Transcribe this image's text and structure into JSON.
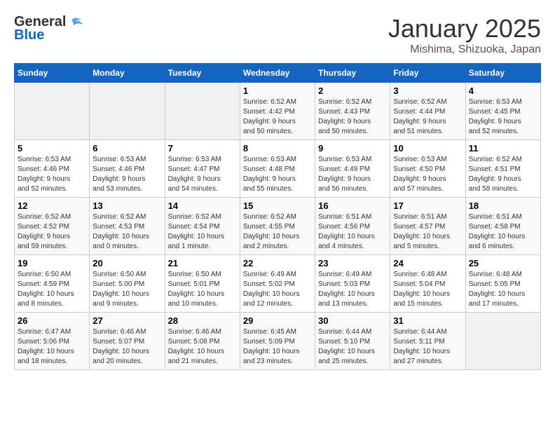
{
  "header": {
    "logo_general": "General",
    "logo_blue": "Blue",
    "month_title": "January 2025",
    "location": "Mishima, Shizuoka, Japan"
  },
  "days_of_week": [
    "Sunday",
    "Monday",
    "Tuesday",
    "Wednesday",
    "Thursday",
    "Friday",
    "Saturday"
  ],
  "weeks": [
    [
      {
        "day": "",
        "info": ""
      },
      {
        "day": "",
        "info": ""
      },
      {
        "day": "",
        "info": ""
      },
      {
        "day": "1",
        "info": "Sunrise: 6:52 AM\nSunset: 4:42 PM\nDaylight: 9 hours\nand 50 minutes."
      },
      {
        "day": "2",
        "info": "Sunrise: 6:52 AM\nSunset: 4:43 PM\nDaylight: 9 hours\nand 50 minutes."
      },
      {
        "day": "3",
        "info": "Sunrise: 6:52 AM\nSunset: 4:44 PM\nDaylight: 9 hours\nand 51 minutes."
      },
      {
        "day": "4",
        "info": "Sunrise: 6:53 AM\nSunset: 4:45 PM\nDaylight: 9 hours\nand 52 minutes."
      }
    ],
    [
      {
        "day": "5",
        "info": "Sunrise: 6:53 AM\nSunset: 4:46 PM\nDaylight: 9 hours\nand 52 minutes."
      },
      {
        "day": "6",
        "info": "Sunrise: 6:53 AM\nSunset: 4:46 PM\nDaylight: 9 hours\nand 53 minutes."
      },
      {
        "day": "7",
        "info": "Sunrise: 6:53 AM\nSunset: 4:47 PM\nDaylight: 9 hours\nand 54 minutes."
      },
      {
        "day": "8",
        "info": "Sunrise: 6:53 AM\nSunset: 4:48 PM\nDaylight: 9 hours\nand 55 minutes."
      },
      {
        "day": "9",
        "info": "Sunrise: 6:53 AM\nSunset: 4:49 PM\nDaylight: 9 hours\nand 56 minutes."
      },
      {
        "day": "10",
        "info": "Sunrise: 6:53 AM\nSunset: 4:50 PM\nDaylight: 9 hours\nand 57 minutes."
      },
      {
        "day": "11",
        "info": "Sunrise: 6:52 AM\nSunset: 4:51 PM\nDaylight: 9 hours\nand 58 minutes."
      }
    ],
    [
      {
        "day": "12",
        "info": "Sunrise: 6:52 AM\nSunset: 4:52 PM\nDaylight: 9 hours\nand 59 minutes."
      },
      {
        "day": "13",
        "info": "Sunrise: 6:52 AM\nSunset: 4:53 PM\nDaylight: 10 hours\nand 0 minutes."
      },
      {
        "day": "14",
        "info": "Sunrise: 6:52 AM\nSunset: 4:54 PM\nDaylight: 10 hours\nand 1 minute."
      },
      {
        "day": "15",
        "info": "Sunrise: 6:52 AM\nSunset: 4:55 PM\nDaylight: 10 hours\nand 2 minutes."
      },
      {
        "day": "16",
        "info": "Sunrise: 6:51 AM\nSunset: 4:56 PM\nDaylight: 10 hours\nand 4 minutes."
      },
      {
        "day": "17",
        "info": "Sunrise: 6:51 AM\nSunset: 4:57 PM\nDaylight: 10 hours\nand 5 minutes."
      },
      {
        "day": "18",
        "info": "Sunrise: 6:51 AM\nSunset: 4:58 PM\nDaylight: 10 hours\nand 6 minutes."
      }
    ],
    [
      {
        "day": "19",
        "info": "Sunrise: 6:50 AM\nSunset: 4:59 PM\nDaylight: 10 hours\nand 8 minutes."
      },
      {
        "day": "20",
        "info": "Sunrise: 6:50 AM\nSunset: 5:00 PM\nDaylight: 10 hours\nand 9 minutes."
      },
      {
        "day": "21",
        "info": "Sunrise: 6:50 AM\nSunset: 5:01 PM\nDaylight: 10 hours\nand 10 minutes."
      },
      {
        "day": "22",
        "info": "Sunrise: 6:49 AM\nSunset: 5:02 PM\nDaylight: 10 hours\nand 12 minutes."
      },
      {
        "day": "23",
        "info": "Sunrise: 6:49 AM\nSunset: 5:03 PM\nDaylight: 10 hours\nand 13 minutes."
      },
      {
        "day": "24",
        "info": "Sunrise: 6:48 AM\nSunset: 5:04 PM\nDaylight: 10 hours\nand 15 minutes."
      },
      {
        "day": "25",
        "info": "Sunrise: 6:48 AM\nSunset: 5:05 PM\nDaylight: 10 hours\nand 17 minutes."
      }
    ],
    [
      {
        "day": "26",
        "info": "Sunrise: 6:47 AM\nSunset: 5:06 PM\nDaylight: 10 hours\nand 18 minutes."
      },
      {
        "day": "27",
        "info": "Sunrise: 6:46 AM\nSunset: 5:07 PM\nDaylight: 10 hours\nand 20 minutes."
      },
      {
        "day": "28",
        "info": "Sunrise: 6:46 AM\nSunset: 5:08 PM\nDaylight: 10 hours\nand 21 minutes."
      },
      {
        "day": "29",
        "info": "Sunrise: 6:45 AM\nSunset: 5:09 PM\nDaylight: 10 hours\nand 23 minutes."
      },
      {
        "day": "30",
        "info": "Sunrise: 6:44 AM\nSunset: 5:10 PM\nDaylight: 10 hours\nand 25 minutes."
      },
      {
        "day": "31",
        "info": "Sunrise: 6:44 AM\nSunset: 5:11 PM\nDaylight: 10 hours\nand 27 minutes."
      },
      {
        "day": "",
        "info": ""
      }
    ]
  ]
}
